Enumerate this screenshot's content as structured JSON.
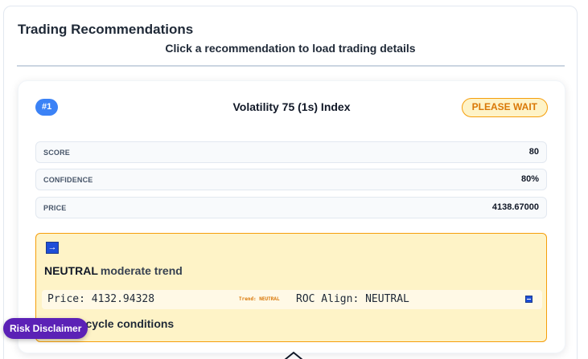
{
  "panel": {
    "title": "Trading Recommendations",
    "subtitle": "Click a recommendation to load trading details"
  },
  "recommendation": {
    "rank": "#1",
    "symbol": "Volatility 75 (1s) Index",
    "status": "PLEASE WAIT",
    "metrics": [
      {
        "label": "SCORE",
        "value": "80"
      },
      {
        "label": "CONFIDENCE",
        "value": "80%"
      },
      {
        "label": "PRICE",
        "value": "4138.67000"
      }
    ],
    "signal": {
      "arrow_icon": "right-arrow-icon",
      "direction": "NEUTRAL",
      "strength": "moderate trend",
      "price_text": "Price: 4132.94328",
      "trend_tag": "Trend: NEUTRAL",
      "roc_text": "ROC Align: NEUTRAL",
      "condition_text": "Poor cycle conditions",
      "condition_icon": "x-mark-icon"
    }
  },
  "footer": {
    "risk_label": "Risk Disclaimer",
    "scroll_icon": "chevron-up-icon"
  },
  "colors": {
    "accent_blue": "#3b82f6",
    "warning_amber": "#f59e0b",
    "risk_purple": "#5b21b6"
  }
}
